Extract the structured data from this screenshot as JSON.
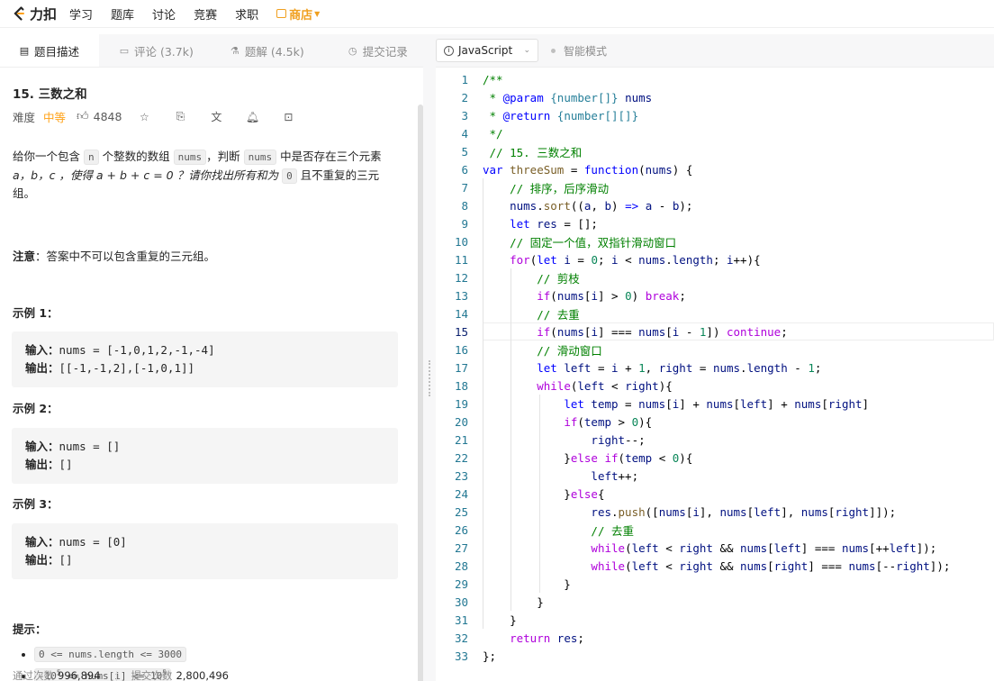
{
  "nav": {
    "logo_text": "力扣",
    "items": [
      "学习",
      "题库",
      "讨论",
      "竞赛",
      "求职"
    ],
    "store": "商店"
  },
  "left_tabs": [
    {
      "label": "题目描述",
      "icon": "document-icon",
      "active": true
    },
    {
      "label": "评论 (3.7k)",
      "icon": "comment-icon",
      "active": false
    },
    {
      "label": "题解 (4.5k)",
      "icon": "flask-icon",
      "active": false
    },
    {
      "label": "提交记录",
      "icon": "clock-icon",
      "active": false
    }
  ],
  "problem": {
    "title": "15. 三数之和",
    "difficulty_label": "难度",
    "difficulty": "中等",
    "likes": "4848",
    "desc_parts": {
      "p1": "给你一个包含",
      "n": "n",
      "p2": "个整数的数组",
      "nums1": "nums",
      "p3": "，判断",
      "nums2": "nums",
      "p4": "中是否存在三个元素",
      "p5": "a，b，c ，使得 a + b + c = 0 ？请你找出所有和为",
      "zero": "0",
      "p6": "且不重复的三元",
      "p7": "组。"
    },
    "note_label": "注意",
    "note_text": "：答案中不可以包含重复的三元组。",
    "examples": [
      {
        "title": "示例 1：",
        "input_label": "输入：",
        "input": "nums = [-1,0,1,2,-1,-4]",
        "output_label": "输出：",
        "output": "[[-1,-1,2],[-1,0,1]]"
      },
      {
        "title": "示例 2：",
        "input_label": "输入：",
        "input": "nums = []",
        "output_label": "输出：",
        "output": "[]"
      },
      {
        "title": "示例 3：",
        "input_label": "输入：",
        "input": "nums = [0]",
        "output_label": "输出：",
        "output": "[]"
      }
    ],
    "hint_title": "提示：",
    "hint1": "0 <= nums.length <= 3000",
    "hint2_a": "-10",
    "hint2_sup": "5",
    "hint2_b": " <= nums[i] <= 10",
    "hint2_sup2": "5",
    "stats_pass_label": "通过次数",
    "stats_pass": "996,894",
    "stats_submit_label": "提交次数",
    "stats_submit": "2,800,496"
  },
  "editor": {
    "language": "JavaScript",
    "smart_mode": "智能模式",
    "current_line": 15
  }
}
